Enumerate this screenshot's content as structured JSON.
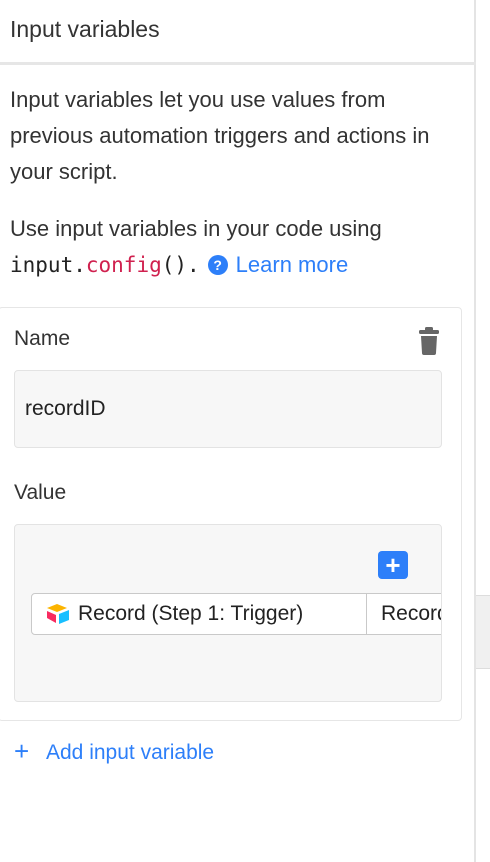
{
  "panel": {
    "title": "Input variables",
    "description": "Input variables let you use values from previous automation triggers and actions in your script.",
    "usage_prefix": "Use input variables in your code using",
    "code_object": "input",
    "code_dot": ".",
    "code_function": "config",
    "code_suffix": "().",
    "help_icon_glyph": "?",
    "learn_more_label": "Learn more"
  },
  "variable": {
    "name_label": "Name",
    "name_value": "recordID",
    "value_label": "Value",
    "plus_glyph": "+",
    "token_record": "Record (Step 1: Trigger)",
    "token_field": "Record"
  },
  "actions": {
    "add_plus_glyph": "+",
    "add_label": "Add input variable"
  },
  "icons": {
    "help": "help-icon",
    "trash": "trash-icon",
    "plus": "plus-icon",
    "logo": "airtable-logo-icon"
  },
  "colors": {
    "accent": "#2d7ff9",
    "code_function": "#d0214f",
    "logo_yellow": "#fcb400",
    "logo_red": "#f82b60",
    "logo_blue": "#18bfff"
  }
}
